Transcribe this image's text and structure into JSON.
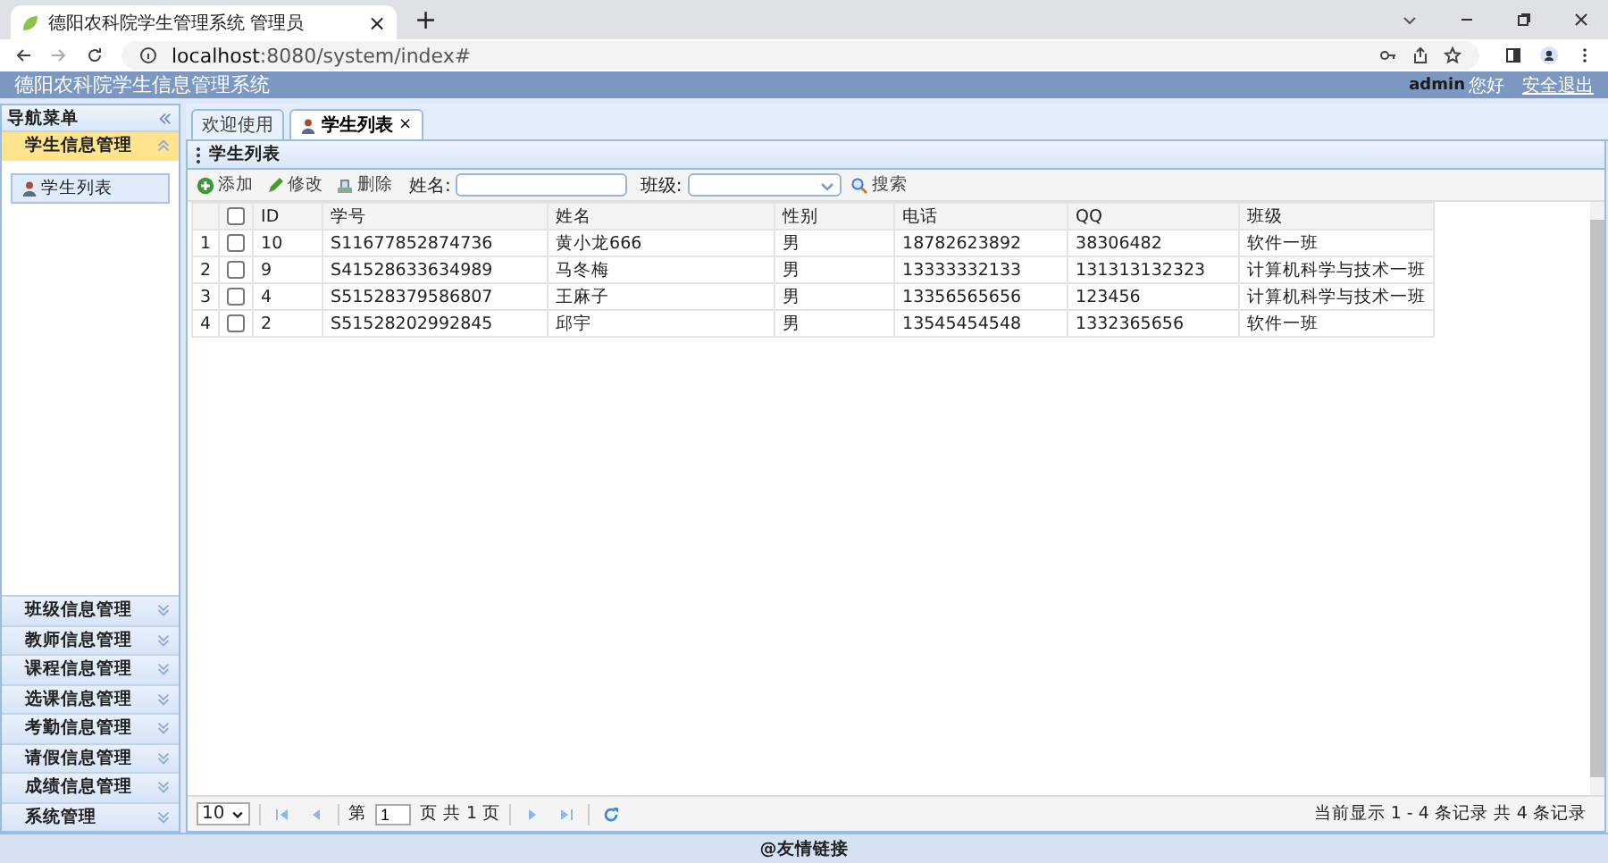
{
  "browser": {
    "tab_title": "德阳农科院学生管理系统 管理员",
    "tab_close": "×",
    "new_tab": "+",
    "url_host": "localhost",
    "url_path": ":8080/system/index#"
  },
  "header": {
    "title": "德阳农科院学生信息管理系统",
    "user": "admin",
    "greeting": "您好",
    "logout": "安全退出"
  },
  "sidebar": {
    "title": "导航菜单",
    "sections": [
      {
        "label": "学生信息管理",
        "expanded": true,
        "items": [
          {
            "label": "学生列表",
            "selected": true
          }
        ]
      },
      {
        "label": "班级信息管理",
        "expanded": false
      },
      {
        "label": "教师信息管理",
        "expanded": false
      },
      {
        "label": "课程信息管理",
        "expanded": false
      },
      {
        "label": "选课信息管理",
        "expanded": false
      },
      {
        "label": "考勤信息管理",
        "expanded": false
      },
      {
        "label": "请假信息管理",
        "expanded": false
      },
      {
        "label": "成绩信息管理",
        "expanded": false
      },
      {
        "label": "系统管理",
        "expanded": false
      }
    ]
  },
  "tabs": [
    {
      "label": "欢迎使用",
      "selected": false
    },
    {
      "label": "学生列表",
      "selected": true,
      "close": "×"
    }
  ],
  "panel_title": "学生列表",
  "toolbar": {
    "buttons": [
      {
        "label": "添加",
        "kind": "add"
      },
      {
        "label": "修改",
        "kind": "edit"
      },
      {
        "label": "删除",
        "kind": "delete"
      }
    ],
    "name_label": "姓名:",
    "class_label": "班级:",
    "search": "搜索"
  },
  "table": {
    "header_checked": false,
    "columns": [
      "ID",
      "学号",
      "姓名",
      "性别",
      "电话",
      "QQ",
      "班级"
    ],
    "rows": [
      {
        "number": "1",
        "checked": false,
        "cells": [
          "10",
          "S11677852874736",
          "黄小龙666",
          "男",
          "18782623892",
          "38306482",
          "软件一班"
        ]
      },
      {
        "number": "2",
        "checked": false,
        "cells": [
          "9",
          "S41528633634989",
          "马冬梅",
          "男",
          "13333332133",
          "131313132323",
          "计算机科学与技术一班"
        ]
      },
      {
        "number": "3",
        "checked": false,
        "cells": [
          "4",
          "S51528379586807",
          "王麻子",
          "男",
          "13356565656",
          "123456",
          "计算机科学与技术一班"
        ]
      },
      {
        "number": "4",
        "checked": false,
        "cells": [
          "2",
          "S51528202992845",
          "邱宇",
          "男",
          "13545454548",
          "1332365656",
          "软件一班"
        ]
      }
    ]
  },
  "pagination": {
    "page_size": "10",
    "before_page": "第",
    "page": "1",
    "after_page": "页 共 1 页",
    "summary": "当前显示 1 - 4 条记录 共 4 条记录"
  },
  "footer": "@友情链接"
}
